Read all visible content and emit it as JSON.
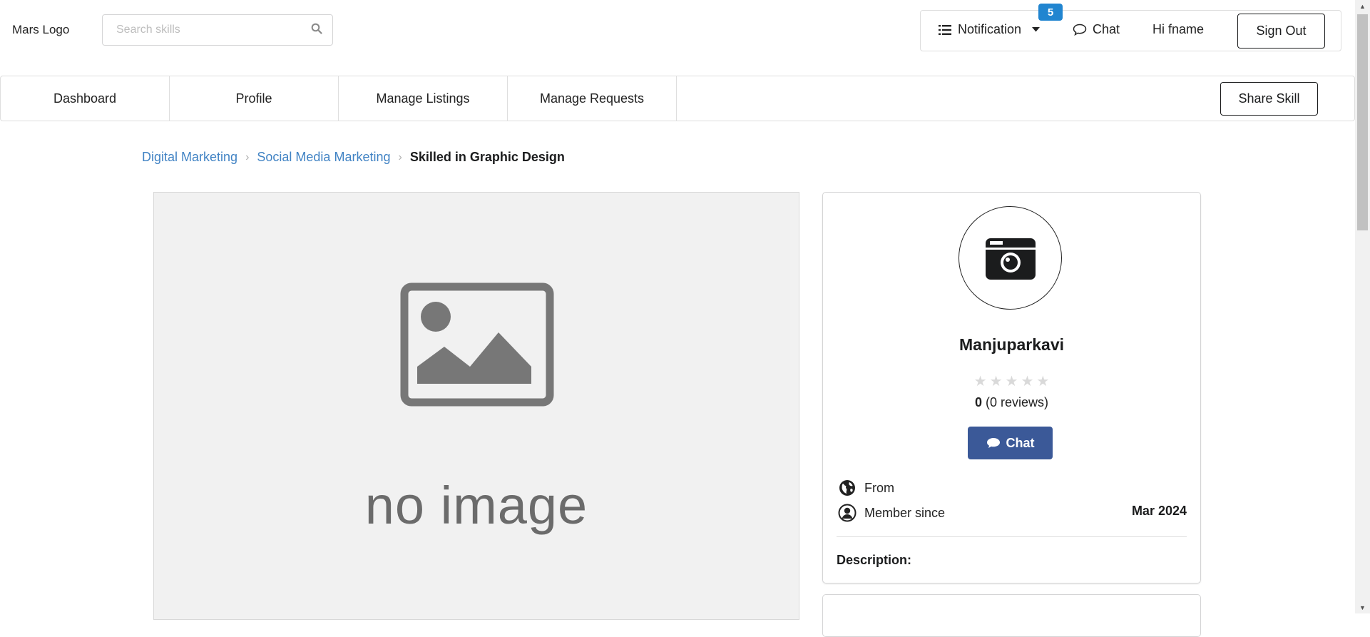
{
  "header": {
    "logo": "Mars Logo",
    "search_placeholder": "Search skills",
    "notification_label": "Notification",
    "notification_count": "5",
    "chat_label": "Chat",
    "greeting": "Hi fname",
    "sign_out_label": "Sign Out"
  },
  "tabs": [
    "Dashboard",
    "Profile",
    "Manage Listings",
    "Manage Requests"
  ],
  "share_skill_label": "Share Skill",
  "breadcrumb": {
    "items": [
      "Digital Marketing",
      "Social Media Marketing"
    ],
    "active": "Skilled in Graphic Design"
  },
  "image_panel": {
    "placeholder_text": "no image"
  },
  "profile": {
    "name": "Manjuparkavi",
    "rating_value": "0",
    "reviews_text": "(0 reviews)",
    "star_count": 5,
    "stars_filled": 0,
    "chat_button_label": "Chat",
    "from_label": "From",
    "member_since_label": "Member since",
    "member_since_value": "Mar 2024",
    "description_label": "Description:"
  },
  "colors": {
    "link": "#4183c4",
    "badge": "#2185d0",
    "chat_button": "#3b5998"
  }
}
